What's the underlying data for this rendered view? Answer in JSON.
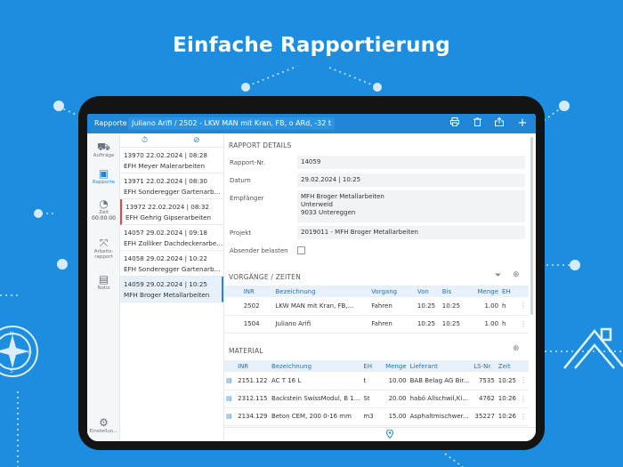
{
  "headline": "Einfache Rapportierung",
  "topbar": {
    "title": "Rapporte",
    "path": "Juliano Arifi / 2502 - LKW MAN mit Kran, FB, o ARd, -32 t",
    "icons": [
      "print-icon",
      "trash-icon",
      "share-icon",
      "add-icon"
    ]
  },
  "nav": {
    "items": [
      {
        "label": "Aufträge",
        "icon": "truck-icon"
      },
      {
        "label": "Rapporte",
        "icon": "save-icon"
      },
      {
        "label": "Zeit",
        "icon": "timer-icon"
      },
      {
        "label": "Arbeits-rapport",
        "icon": "expand-icon"
      },
      {
        "label": "Notiz",
        "icon": "note-icon"
      },
      {
        "label": "Einstellun...",
        "icon": "gear-icon"
      }
    ],
    "timer": "00:00:00"
  },
  "list": {
    "items": [
      {
        "line1": "13970  22.02.2024 | 08:28",
        "line2": "EFH Meyer Malerarbeiten"
      },
      {
        "line1": "13971  22.02.2024 | 08:30",
        "line2": "EFH Sonderegger Gartenarb..."
      },
      {
        "line1": "13972  22.02.2024 | 08:32",
        "line2": "EFH Gehrig Gipserarbeiten"
      },
      {
        "line1": "14057  29.02.2024 | 09:18",
        "line2": "EFH Zolliker Dachdeckerarbe..."
      },
      {
        "line1": "14058  29.02.2024 | 10:22",
        "line2": "EFH Sonderegger Gartenarb..."
      },
      {
        "line1": "14059  29.02.2024 | 10:25",
        "line2": "MFH Broger Metallarbeiten"
      }
    ]
  },
  "details": {
    "section_title": "RAPPORT DETAILS",
    "nr_label": "Rapport-Nr.",
    "nr_value": "14059",
    "date_label": "Datum",
    "date_value": "29.02.2024 | 10:25",
    "recipient_label": "Empfänger",
    "recipient_line1": "MFH Broger Metallarbeiten",
    "recipient_line2": "Unterweid",
    "recipient_line3": "9033 Untereggen",
    "project_label": "Projekt",
    "project_value": "2019011 - MFH Broger Metallarbeiten",
    "sender_label": "Absender belasten"
  },
  "vorgaenge": {
    "section_title": "VORGÄNGE / ZEITEN",
    "headers": [
      "INR",
      "Bezeichnung",
      "Vorgang",
      "Von",
      "Bis",
      "Menge",
      "EH"
    ],
    "rows": [
      [
        "2502",
        "LKW MAN mit Kran, FB,...",
        "Fahren",
        "10:25",
        "10:25",
        "1.00",
        "h"
      ],
      [
        "1504",
        "Juliano Arifi",
        "Fahren",
        "10:25",
        "10:25",
        "1.00",
        "h"
      ]
    ]
  },
  "material": {
    "section_title": "MATERIAL",
    "headers": [
      "INR",
      "Bezeichnung",
      "EH",
      "Menge",
      "Lieferant",
      "LS-Nr.",
      "Zeit"
    ],
    "rows": [
      [
        "2151.122",
        "AC T 16 L",
        "t",
        "10.00",
        "BAB Belag AG Bir...",
        "7535",
        "10:25"
      ],
      [
        "2312.115",
        "Backstein SwissModul, B 1...",
        "St",
        "20.00",
        "habö Allschwil,Ki...",
        "4762",
        "10:26"
      ],
      [
        "2134.129",
        "Beton CEM, 200 0-16 mm",
        "m3",
        "15.00",
        "Asphaltmischwer...",
        "35227",
        "10:26"
      ]
    ]
  },
  "colors": {
    "background": "#1d8ddf",
    "accent": "#1f87d6",
    "flag": "#e04848"
  }
}
